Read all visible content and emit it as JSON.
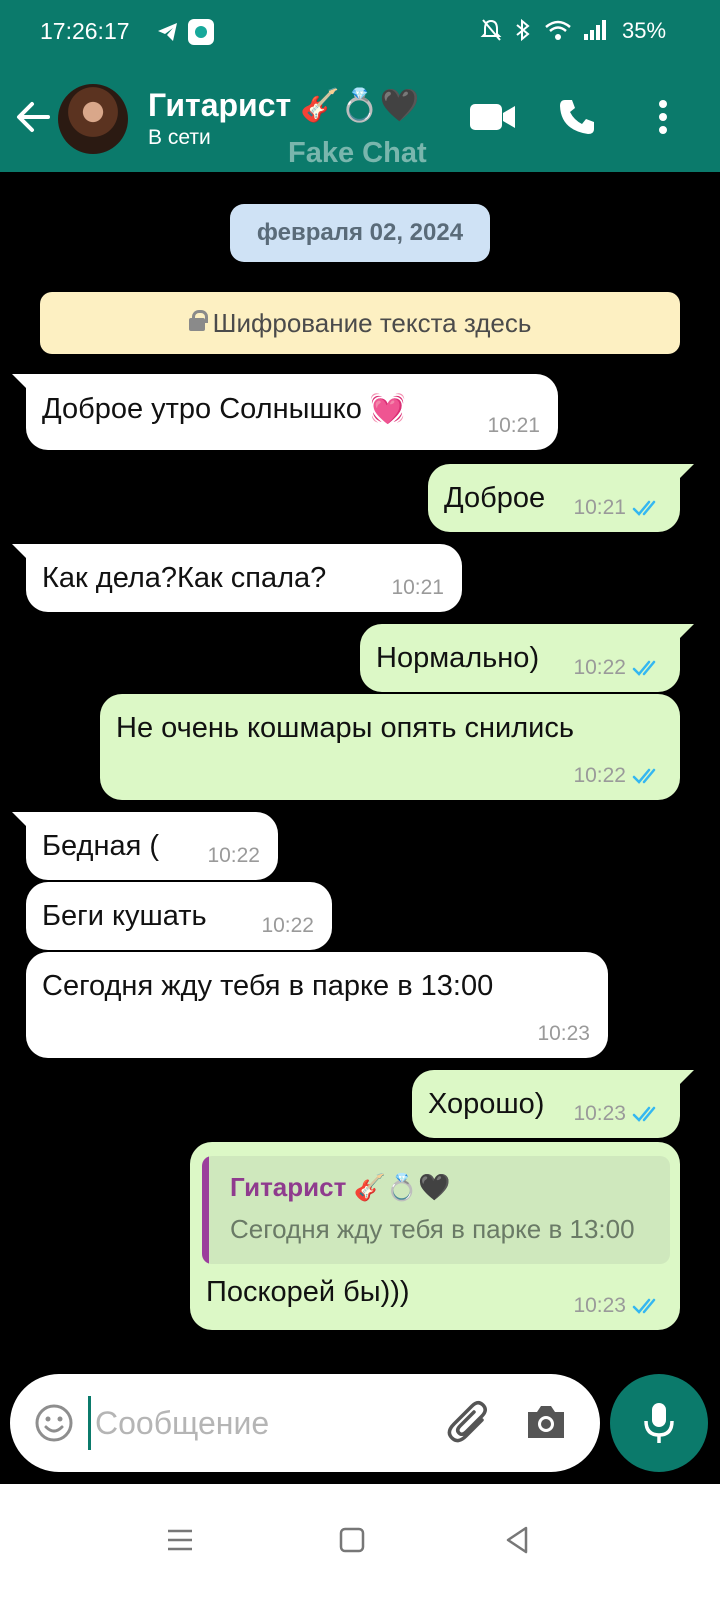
{
  "status_bar": {
    "time": "17:26:17",
    "battery": "35%",
    "icons": [
      "telegram-icon",
      "app-notification-icon",
      "bell-muted-icon",
      "bluetooth-icon",
      "wifi-icon",
      "signal-icon"
    ]
  },
  "header": {
    "contact_name": "Гитарист 🎸💍🖤",
    "status": "В сети",
    "watermark": "Fake Chat",
    "icons": [
      "back-arrow-icon",
      "video-call-icon",
      "phone-icon",
      "more-vert-icon"
    ]
  },
  "chat": {
    "date": "февраля 02, 2024",
    "encryption_notice": "Шифрование текста здесь",
    "messages": [
      {
        "direction": "in",
        "text": "Доброе утро Солнышко 💓",
        "time": "10:21"
      },
      {
        "direction": "out",
        "text": "Доброе",
        "time": "10:21",
        "read": true
      },
      {
        "direction": "in",
        "text": "Как дела?Как спала?",
        "time": "10:21"
      },
      {
        "direction": "out",
        "text": "Нормально)",
        "time": "10:22",
        "read": true
      },
      {
        "direction": "out",
        "text": "Не очень кошмары опять снились",
        "time": "10:22",
        "read": true
      },
      {
        "direction": "in",
        "text": "Бедная (",
        "time": "10:22"
      },
      {
        "direction": "in",
        "text": "Беги кушать",
        "time": "10:22"
      },
      {
        "direction": "in",
        "text": "Сегодня жду тебя в парке в 13:00",
        "time": "10:23"
      },
      {
        "direction": "out",
        "text": "Хорошо)",
        "time": "10:23",
        "read": true
      },
      {
        "direction": "out",
        "text": "Поскорей бы)))",
        "time": "10:23",
        "read": true,
        "quote": {
          "author": "Гитарист 🎸💍🖤",
          "text": "Сегодня жду тебя в парке в 13:00"
        }
      }
    ]
  },
  "composer": {
    "placeholder": "Сообщение",
    "value": "",
    "icons": [
      "emoji-icon",
      "attach-icon",
      "camera-icon",
      "mic-icon"
    ]
  },
  "nav_bar": {
    "icons": [
      "recents-icon",
      "home-icon",
      "back-icon"
    ]
  },
  "colors": {
    "accent": "#0b7a6b",
    "outgoing_bubble": "#dcf8c6",
    "incoming_bubble": "#ffffff",
    "read_ticks": "#34b7f1",
    "quote_author": "#8f3b8e"
  }
}
